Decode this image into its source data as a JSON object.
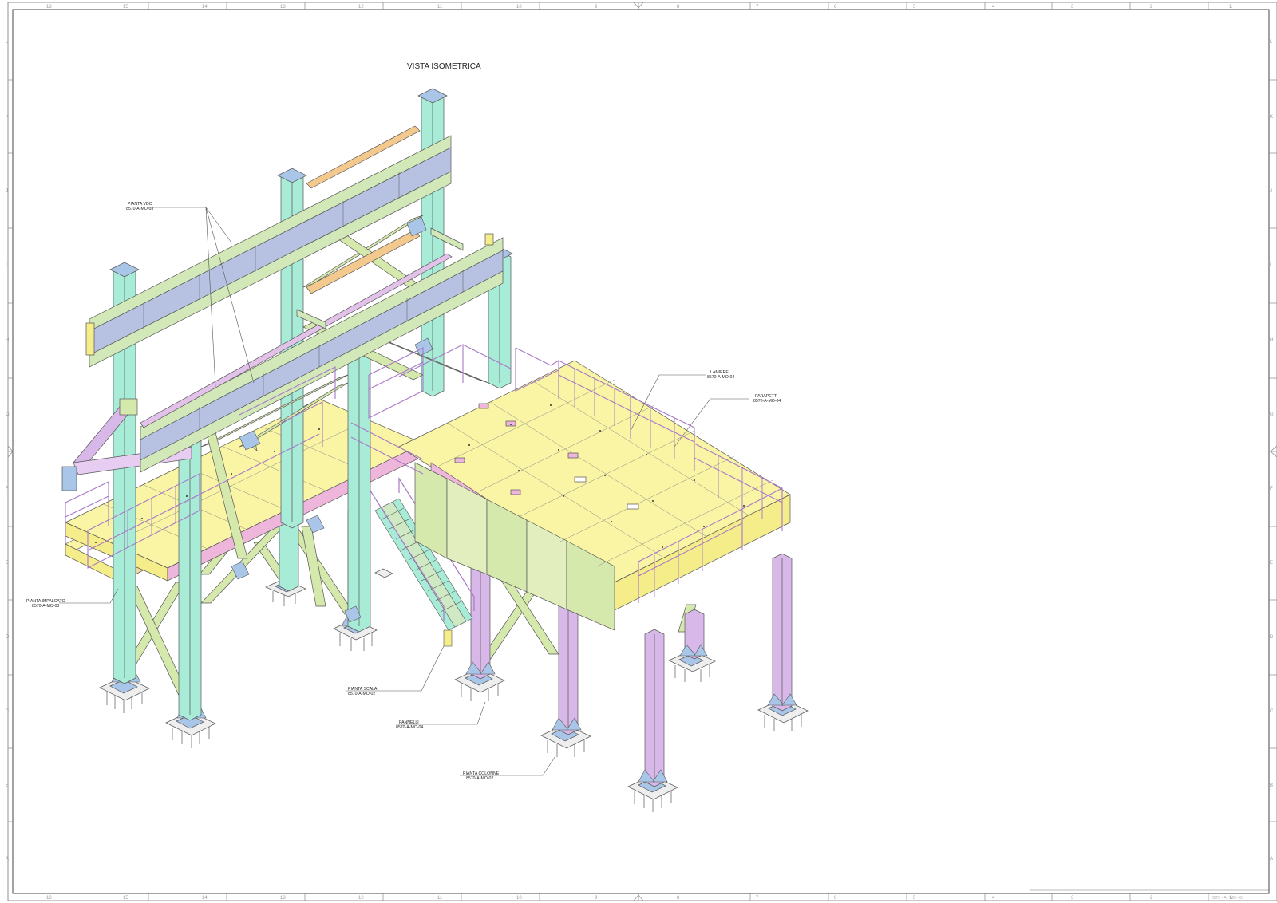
{
  "drawing": {
    "title": "VISTA ISOMETRICA",
    "code": "8570 - A - MO - 01"
  },
  "frame": {
    "columns": [
      "16",
      "15",
      "14",
      "13",
      "12",
      "11",
      "10",
      "9",
      "8",
      "7",
      "6",
      "5",
      "4",
      "3",
      "2",
      "1"
    ],
    "rows": [
      "A",
      "B",
      "C",
      "D",
      "E",
      "F",
      "G",
      "H",
      "I",
      "J",
      "K",
      "L"
    ]
  },
  "callouts": [
    {
      "id": "pianta-vdc",
      "name": "PIANTA VDC",
      "ref": "8570-A-MO-03"
    },
    {
      "id": "pianta-impalcato",
      "name": "PIANTA IMPALCATO",
      "ref": "8570-A-MO-03"
    },
    {
      "id": "pianta-scala",
      "name": "PIANTA SCALA",
      "ref": "8570-A-MO-02"
    },
    {
      "id": "pannelli",
      "name": "PANNELLI",
      "ref": "8570-A-MO-04"
    },
    {
      "id": "pianta-colonne",
      "name": "PIANTA COLONNE",
      "ref": "8570-A-MO-02"
    },
    {
      "id": "lamiere",
      "name": "LAMIERE",
      "ref": "8570-A-MO-04"
    },
    {
      "id": "parapetti",
      "name": "PARAPETTI",
      "ref": "8570-A-MO-04"
    }
  ],
  "colors": {
    "column": "#a8ecd8",
    "beam": "#d3e8b8",
    "beam_web": "#b7c2e3",
    "deck": "#faf5a4",
    "bracing": "#d6e9ad",
    "purple": "#d8b8e8",
    "pink": "#efb6dc",
    "orange": "#f4c98d",
    "baseplate": "#a9c6e8",
    "yellow": "#f5ec8a"
  }
}
